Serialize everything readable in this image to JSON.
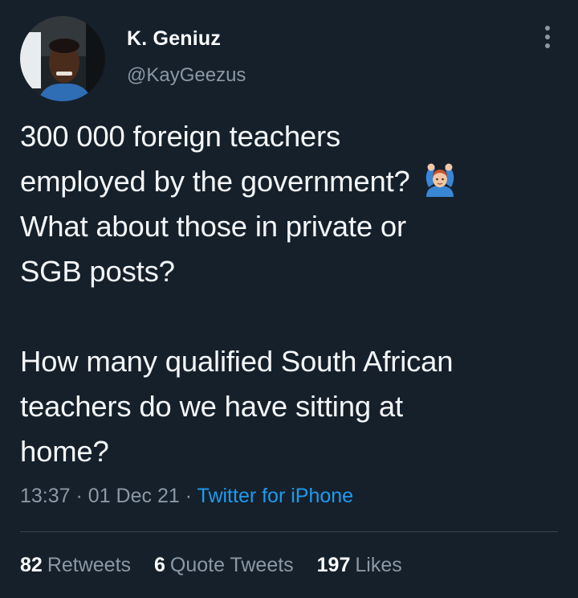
{
  "user": {
    "display_name": "K. Geniuz",
    "handle": "@KayGeezus",
    "avatar_icon": "profile-photo"
  },
  "tweet": {
    "lines": [
      "300 000 foreign teachers",
      "employed by the government?",
      "What about those in private or",
      "SGB posts?",
      "How many qualified South African",
      "teachers do we have sitting at",
      "home?"
    ],
    "emoji_icon": "man-gesturing-ok-icon"
  },
  "meta": {
    "time": "13:37",
    "separator": "·",
    "date": "01 Dec 21",
    "source": "Twitter for iPhone"
  },
  "stats": {
    "retweets_count": "82",
    "retweets_label": "Retweets",
    "quotes_count": "6",
    "quotes_label": "Quote Tweets",
    "likes_count": "197",
    "likes_label": "Likes"
  },
  "colors": {
    "background": "#15202b",
    "primary_text": "#f5f7f9",
    "secondary_text": "#8b98a5",
    "link": "#1d9bf0",
    "divider": "#38444d"
  }
}
